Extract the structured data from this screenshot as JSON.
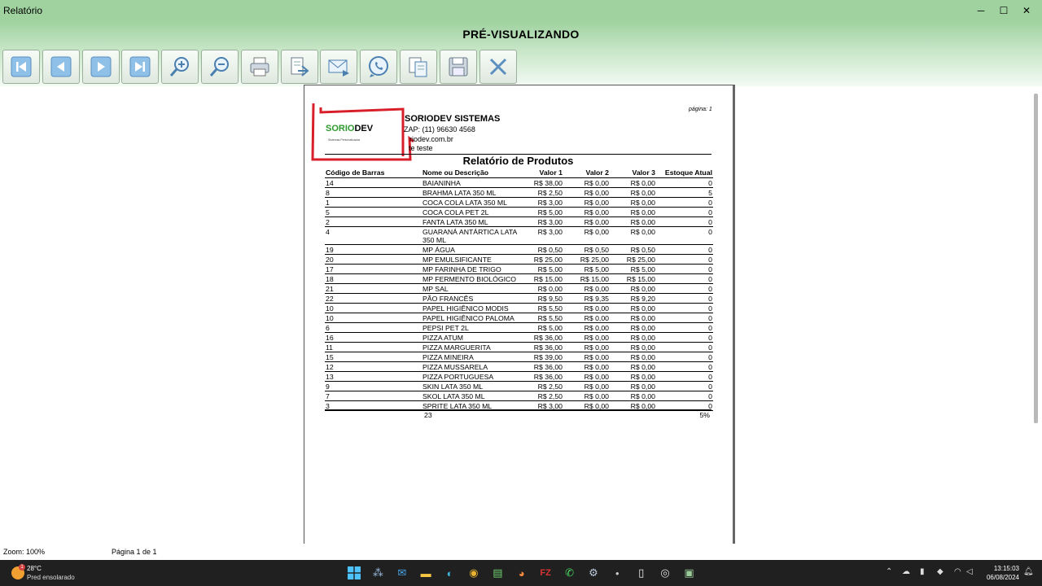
{
  "window": {
    "title": "Relatório",
    "controls": {
      "minimize": "─",
      "maximize": "☐",
      "close": "✕"
    }
  },
  "header": {
    "mode_title": "PRÉ-VISUALIZANDO"
  },
  "toolbar": {
    "buttons": [
      {
        "name": "first-page-button",
        "icon": "first-page-icon"
      },
      {
        "name": "previous-page-button",
        "icon": "previous-page-icon"
      },
      {
        "name": "next-page-button",
        "icon": "next-page-icon"
      },
      {
        "name": "last-page-button",
        "icon": "last-page-icon"
      },
      {
        "name": "zoom-in-button",
        "icon": "zoom-in-icon"
      },
      {
        "name": "zoom-out-button",
        "icon": "zoom-out-icon"
      },
      {
        "name": "print-button",
        "icon": "printer-icon"
      },
      {
        "name": "export-button",
        "icon": "export-icon"
      },
      {
        "name": "email-button",
        "icon": "envelope-icon"
      },
      {
        "name": "whatsapp-button",
        "icon": "whatsapp-icon"
      },
      {
        "name": "copy-button",
        "icon": "copy-icon"
      },
      {
        "name": "save-button",
        "icon": "floppy-icon"
      },
      {
        "name": "close-preview-button",
        "icon": "close-icon"
      }
    ]
  },
  "report": {
    "page_label": "página: 1",
    "logo": {
      "word_green": "SORIO",
      "word_black": "DEV",
      "tagline": "Sistemas Personalizados"
    },
    "company_name": "SORIODEV SISTEMAS",
    "company_phone": "ZAP: (11) 96630 4568",
    "company_site": "riodev.com.br",
    "company_note": "te teste",
    "title": "Relatório de Produtos",
    "columns": [
      "Código de Barras",
      "Nome ou Descrição",
      "Valor 1",
      "Valor 2",
      "Valor 3",
      "Estoque Atual"
    ],
    "rows": [
      [
        "14",
        "BAIANINHA",
        "R$ 38,00",
        "R$ 0,00",
        "R$ 0,00",
        "0"
      ],
      [
        "8",
        "BRAHMA LATA 350 ML",
        "R$ 2,50",
        "R$ 0,00",
        "R$ 0,00",
        "5"
      ],
      [
        "1",
        "COCA COLA LATA 350 ML",
        "R$ 3,00",
        "R$ 0,00",
        "R$ 0,00",
        "0"
      ],
      [
        "5",
        "COCA COLA PET 2L",
        "R$ 5,00",
        "R$ 0,00",
        "R$ 0,00",
        "0"
      ],
      [
        "2",
        "FANTA LATA 350 ML",
        "R$ 3,00",
        "R$ 0,00",
        "R$ 0,00",
        "0"
      ],
      [
        "4",
        "GUARANÁ ANTÁRTICA LATA 350 ML",
        "R$ 3,00",
        "R$ 0,00",
        "R$ 0,00",
        "0"
      ],
      [
        "19",
        "MP ÁGUA",
        "R$ 0,50",
        "R$ 0,50",
        "R$ 0,50",
        "0"
      ],
      [
        "20",
        "MP EMULSIFICANTE",
        "R$ 25,00",
        "R$ 25,00",
        "R$ 25,00",
        "0"
      ],
      [
        "17",
        "MP FARINHA DE TRIGO",
        "R$ 5,00",
        "R$ 5,00",
        "R$ 5,00",
        "0"
      ],
      [
        "18",
        "MP FERMENTO BIOLÓGICO",
        "R$ 15,00",
        "R$ 15,00",
        "R$ 15,00",
        "0"
      ],
      [
        "21",
        "MP SAL",
        "R$ 0,00",
        "R$ 0,00",
        "R$ 0,00",
        "0"
      ],
      [
        "22",
        "PÃO FRANCÊS",
        "R$ 9,50",
        "R$ 9,35",
        "R$ 9,20",
        "0"
      ],
      [
        "10",
        "PAPEL HIGIÊNICO MODIS",
        "R$ 5,50",
        "R$ 0,00",
        "R$ 0,00",
        "0"
      ],
      [
        "10",
        "PAPEL HIGIÊNICO PALOMA",
        "R$ 5,50",
        "R$ 0,00",
        "R$ 0,00",
        "0"
      ],
      [
        "6",
        "PEPSI PET 2L",
        "R$ 5,00",
        "R$ 0,00",
        "R$ 0,00",
        "0"
      ],
      [
        "16",
        "PIZZA ATUM",
        "R$ 36,00",
        "R$ 0,00",
        "R$ 0,00",
        "0"
      ],
      [
        "11",
        "PIZZA MARGUERITA",
        "R$ 36,00",
        "R$ 0,00",
        "R$ 0,00",
        "0"
      ],
      [
        "15",
        "PIZZA MINEIRA",
        "R$ 39,00",
        "R$ 0,00",
        "R$ 0,00",
        "0"
      ],
      [
        "12",
        "PIZZA MUSSARELA",
        "R$ 36,00",
        "R$ 0,00",
        "R$ 0,00",
        "0"
      ],
      [
        "13",
        "PIZZA PORTUGUESA",
        "R$ 36,00",
        "R$ 0,00",
        "R$ 0,00",
        "0"
      ],
      [
        "9",
        "SKIN LATA 350 ML",
        "R$ 2,50",
        "R$ 0,00",
        "R$ 0,00",
        "0"
      ],
      [
        "7",
        "SKOL LATA 350 ML",
        "R$ 2,50",
        "R$ 0,00",
        "R$ 0,00",
        "0"
      ],
      [
        "3",
        "SPRITE LATA 350 ML",
        "R$ 3,00",
        "R$ 0,00",
        "R$ 0,00",
        "0"
      ]
    ],
    "total_count": "23",
    "total_stock": "5%"
  },
  "status": {
    "zoom": "Zoom: 100%",
    "page": "Página 1 de 1"
  },
  "taskbar": {
    "weather_badge": "1",
    "weather_temp": "28°C",
    "weather_desc": "Pred ensolarado",
    "time": "13:15:03",
    "date": "06/08/2024"
  },
  "colors": {
    "titlebar": "#9fd29f",
    "annotation_red": "#d81e28",
    "taskbar": "#202020"
  }
}
